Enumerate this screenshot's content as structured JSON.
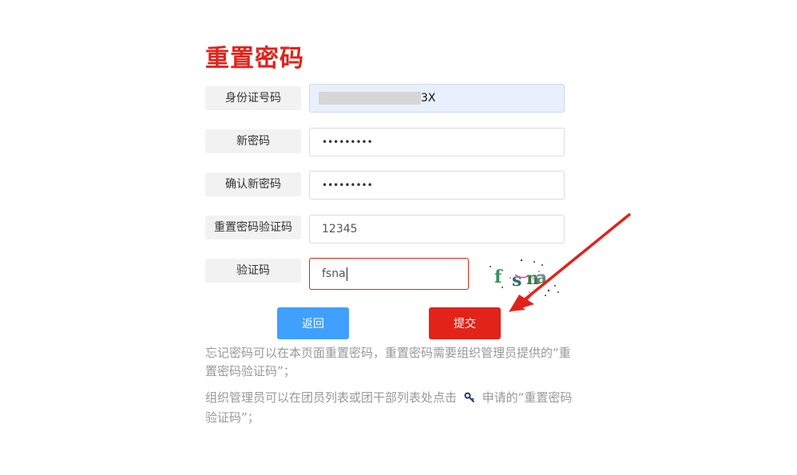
{
  "page": {
    "title": "重置密码"
  },
  "form": {
    "id_label": "身份证号码",
    "id_value_suffix": "3X",
    "new_password_label": "新密码",
    "new_password_mask": "•••••••••",
    "confirm_password_label": "确认新密码",
    "confirm_password_mask": "•••••••••",
    "reset_code_label": "重置密码验证码",
    "reset_code_value": "12345",
    "captcha_label": "验证码",
    "captcha_value": "fsna",
    "captcha_image_text": "fsna"
  },
  "buttons": {
    "back_label": "返回",
    "submit_label": "提交"
  },
  "notes": {
    "line1": "忘记密码可以在本页面重置密码，重置密码需要组织管理员提供的“重置密码验证码”；",
    "line2_before_icon": "组织管理员可以在团员列表或团干部列表处点击",
    "line2_after_icon": "申请的“重置密码验证码”；"
  },
  "colors": {
    "accent_red": "#e2231a",
    "button_blue": "#40a0ff",
    "annotation_arrow": "#e2231a"
  },
  "icons": {
    "key": "key-icon"
  }
}
